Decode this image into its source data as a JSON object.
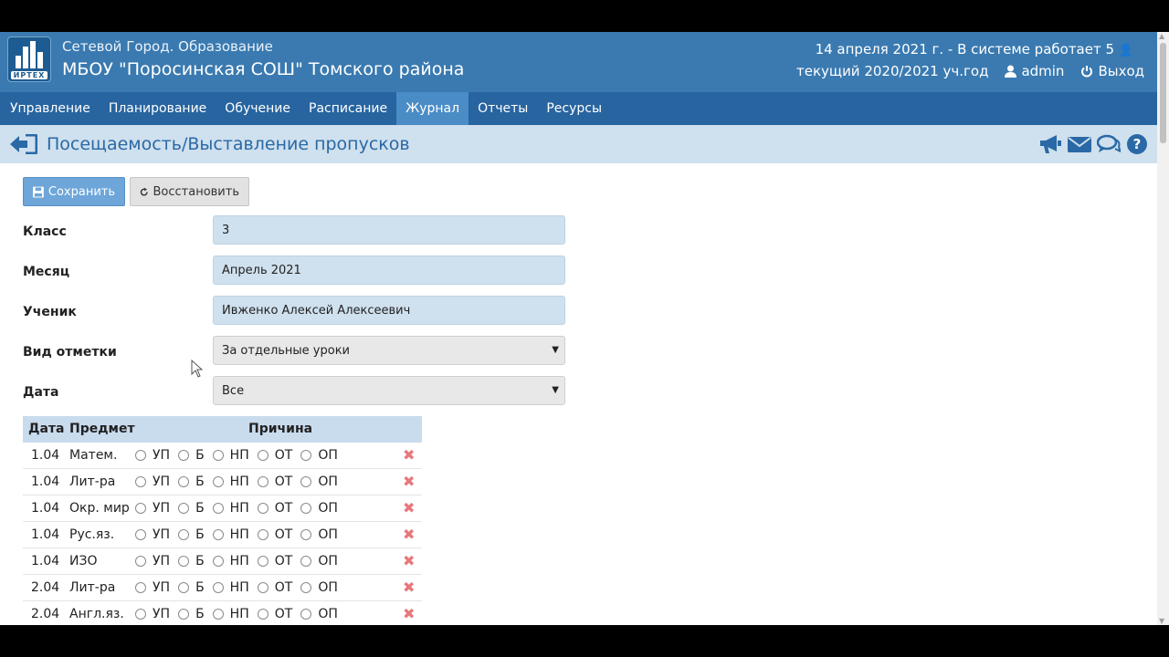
{
  "header": {
    "subtitle": "Сетевой Город. Образование",
    "title": "МБОУ \"Поросинская СОШ\" Томского района",
    "logo_text": "ИРТЕХ",
    "date_info": "14 апреля 2021 г. - В системе работает 5",
    "year": "текущий 2020/2021 уч.год",
    "user": "admin",
    "logout": "Выход"
  },
  "nav": {
    "tabs": [
      "Управление",
      "Планирование",
      "Обучение",
      "Расписание",
      "Журнал",
      "Отчеты",
      "Ресурсы"
    ],
    "active": "Журнал"
  },
  "page": {
    "title": "Посещаемость/Выставление пропусков"
  },
  "toolbar": {
    "save_label": "Сохранить",
    "restore_label": "Восстановить"
  },
  "form": {
    "class_label": "Класс",
    "class_value": "3",
    "month_label": "Месяц",
    "month_value": "Апрель 2021",
    "student_label": "Ученик",
    "student_value": "Ивженко Алексей Алексеевич",
    "mark_type_label": "Вид отметки",
    "mark_type_value": "За отдельные уроки",
    "date_label": "Дата",
    "date_value": "Все"
  },
  "table": {
    "headers": {
      "date": "Дата",
      "subject": "Предмет",
      "reason": "Причина"
    },
    "reasons": [
      "УП",
      "Б",
      "НП",
      "ОТ",
      "ОП"
    ],
    "rows": [
      {
        "date": "1.04",
        "subject": "Матем."
      },
      {
        "date": "1.04",
        "subject": "Лит-ра"
      },
      {
        "date": "1.04",
        "subject": "Окр. мир"
      },
      {
        "date": "1.04",
        "subject": "Рус.яз."
      },
      {
        "date": "1.04",
        "subject": "ИЗО"
      },
      {
        "date": "2.04",
        "subject": "Лит-ра"
      },
      {
        "date": "2.04",
        "subject": "Англ.яз."
      }
    ]
  },
  "colors": {
    "header_bg": "#3a7ab0",
    "nav_bg": "#2764a0",
    "active_tab": "#4a8cc6",
    "title_bar": "#cfe0ee",
    "title_text": "#2a69a5",
    "delete_icon": "#e8787b"
  }
}
